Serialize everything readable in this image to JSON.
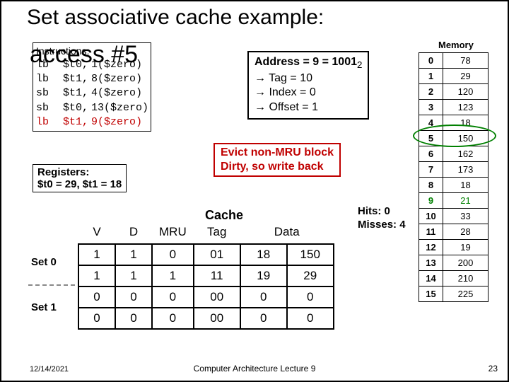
{
  "title": "Set associative cache example:",
  "overlay": "access #5",
  "instructions": {
    "header": "Instructions:",
    "rows": [
      {
        "op": "lb",
        "reg": "$t0,",
        "arg": "1($zero)"
      },
      {
        "op": "lb",
        "reg": "$t1,",
        "arg": "8($zero)"
      },
      {
        "op": "sb",
        "reg": "$t1,",
        "arg": "4($zero)"
      },
      {
        "op": "sb",
        "reg": "$t0,",
        "arg": "13($zero)"
      },
      {
        "op": "lb",
        "reg": "$t1,",
        "arg": "9($zero)"
      }
    ],
    "highlight_index": 4
  },
  "address_box": {
    "line1": "Address = 9 = 1001",
    "sub": "2",
    "line2": "→ Tag = 10",
    "line3": "→ Index = 0",
    "line4": "→ Offset = 1"
  },
  "evict": {
    "line1": "Evict non-MRU block",
    "line2": "Dirty, so write back"
  },
  "registers": {
    "line1": "Registers:",
    "line2": "$t0 = 29, $t1 = 18"
  },
  "hitmiss": {
    "hits": "Hits: 0",
    "misses": "Misses: 4"
  },
  "cache": {
    "label": "Cache",
    "headers": {
      "V": "V",
      "D": "D",
      "MRU": "MRU",
      "Tag": "Tag",
      "Data": "Data"
    },
    "rows": [
      {
        "V": "1",
        "D": "1",
        "MRU": "0",
        "Tag": "01",
        "Da": "18",
        "Db": "150"
      },
      {
        "V": "1",
        "D": "1",
        "MRU": "1",
        "Tag": "11",
        "Da": "19",
        "Db": "29"
      },
      {
        "V": "0",
        "D": "0",
        "MRU": "0",
        "Tag": "00",
        "Da": "0",
        "Db": "0"
      },
      {
        "V": "0",
        "D": "0",
        "MRU": "0",
        "Tag": "00",
        "Da": "0",
        "Db": "0"
      }
    ],
    "set0": "Set 0",
    "set1": "Set 1"
  },
  "memory": {
    "label": "Memory",
    "rows": [
      {
        "i": "0",
        "v": "78"
      },
      {
        "i": "1",
        "v": "29"
      },
      {
        "i": "2",
        "v": "120"
      },
      {
        "i": "3",
        "v": "123"
      },
      {
        "i": "4",
        "v": "18"
      },
      {
        "i": "5",
        "v": "150"
      },
      {
        "i": "6",
        "v": "162"
      },
      {
        "i": "7",
        "v": "173"
      },
      {
        "i": "8",
        "v": "18"
      },
      {
        "i": "9",
        "v": "21"
      },
      {
        "i": "10",
        "v": "33"
      },
      {
        "i": "11",
        "v": "28"
      },
      {
        "i": "12",
        "v": "19"
      },
      {
        "i": "13",
        "v": "200"
      },
      {
        "i": "14",
        "v": "210"
      },
      {
        "i": "15",
        "v": "225"
      }
    ],
    "highlight_index": 9
  },
  "footer": {
    "date": "12/14/2021",
    "center": "Computer Architecture Lecture 9",
    "page": "23"
  }
}
